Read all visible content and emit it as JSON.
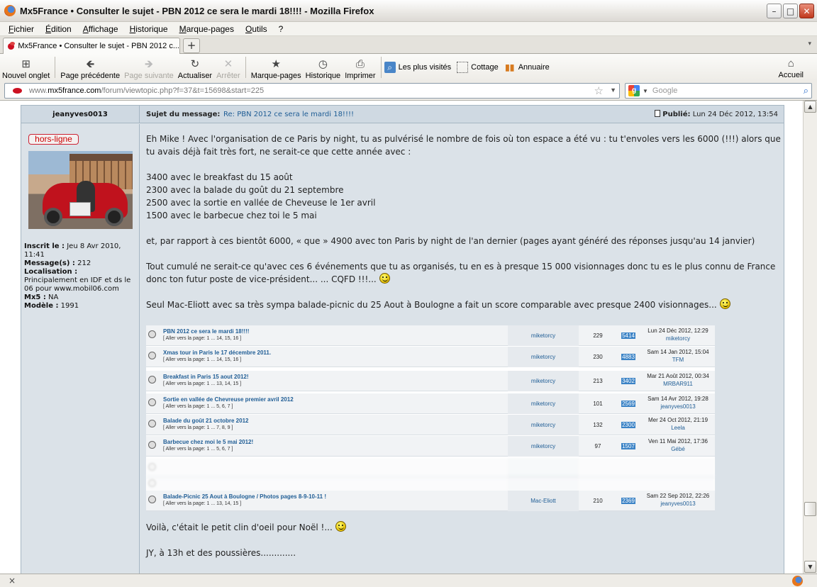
{
  "window": {
    "title": "Mx5France • Consulter le sujet - PBN 2012 ce sera le mardi 18!!!! - Mozilla Firefox",
    "minimize": "–",
    "maximize": "□",
    "close": "✕"
  },
  "menubar": {
    "items": [
      "Fichier",
      "Édition",
      "Affichage",
      "Historique",
      "Marque-pages",
      "Outils",
      "?"
    ]
  },
  "tabs": {
    "active_label": "Mx5France • Consulter le sujet - PBN 2012 c...",
    "new_tab": "+",
    "scroll": "▾"
  },
  "navbar": {
    "new_tab": "Nouvel onglet",
    "back": "Page précédente",
    "forward": "Page suivante",
    "reload": "Actualiser",
    "stop": "Arrêter",
    "bookmarks": "Marque-pages",
    "history": "Historique",
    "print": "Imprimer",
    "home": "Accueil",
    "bookmark_links": [
      "Les plus visités",
      "Cottage",
      "Annuaire"
    ]
  },
  "urlbar": {
    "prefix": "www.",
    "domain": "mx5france.com",
    "path": "/forum/viewtopic.php?f=37&t=15698&start=225",
    "search_placeholder": "Google"
  },
  "post": {
    "author": "jeanyves0013",
    "subject_label": "Sujet du message:",
    "subject": "Re: PBN 2012 ce sera le mardi 18!!!!",
    "posted_label": "Publié:",
    "posted_date": "Lun 24 Déc 2012, 13:54",
    "status_badge": "hors-ligne",
    "profile": {
      "joined_label": "Inscrit le :",
      "joined": "Jeu 8 Avr 2010, 11:41",
      "messages_label": "Message(s) :",
      "messages": "212",
      "location_label": "Localisation :",
      "location": "Principalement en IDF et ds le 06 pour www.mobil06.com",
      "mx5_label": "Mx5 :",
      "mx5": "NA",
      "model_label": "Modèle :",
      "model": "1991"
    },
    "paragraphs": {
      "p1": "Eh Mike ! Avec l'organisation de ce Paris by night, tu as pulvérisé le nombre de fois où ton espace a été vu : tu t'envoles vers les 6000 (!!!) alors que tu avais déjà fait très fort, ne serait-ce que cette année avec :",
      "l1": "3400 avec le breakfast du 15 août",
      "l2": "2300 avec la balade du goût du 21 septembre",
      "l3": "2500 avec la sortie en vallée de Cheveuse le 1er avril",
      "l4": "1500 avec le barbecue chez toi le 5 mai",
      "p2": "et, par rapport à ces bientôt 6000, « que » 4900 avec ton Paris by night de l'an dernier (pages ayant généré des réponses jusqu'au 14 janvier)",
      "p3": "Tout cumulé ne serait-ce qu'avec ces 6 événements que tu as organisés, tu en es à presque 15 000 visionnages donc tu es le plus connu de France donc ton futur poste de vice-président... ... CQFD !!!...",
      "p4": "Seul Mac-Eliott avec sa très sympa balade-picnic du 25 Aout à Boulogne a fait un score comparable avec presque 2400 visionnages...",
      "p5": "Voilà, c'était le petit clin d'oeil pour Noël !...",
      "p6": "JY, à 13h et des poussières............."
    },
    "embedded_topics": [
      {
        "title": "PBN 2012 ce sera le mardi 18!!!!",
        "pages": "[ Aller vers la page: 1 ... 14, 15, 16 ]",
        "author": "miketorcy",
        "replies": "229",
        "views": "5414",
        "last_date": "Lun 24 Déc 2012, 12:29",
        "last_user": "miketorcy"
      },
      {
        "title": "Xmas tour in Paris le 17 décembre 2011.",
        "pages": "[ Aller vers la page: 1 ... 14, 15, 16 ]",
        "author": "miketorcy",
        "replies": "230",
        "views": "4883",
        "last_date": "Sam 14 Jan 2012, 15:04",
        "last_user": "TFM"
      },
      {
        "title": "Breakfast in Paris 15 aout 2012!",
        "pages": "[ Aller vers la page: 1 ... 13, 14, 15 ]",
        "author": "miketorcy",
        "replies": "213",
        "views": "3402",
        "last_date": "Mar 21 Août 2012, 00:34",
        "last_user": "MRBAR911"
      },
      {
        "title": "Sortie en vallée de Chevreuse premier avril 2012",
        "pages": "[ Aller vers la page: 1 ... 5, 6, 7 ]",
        "author": "miketorcy",
        "replies": "101",
        "views": "2569",
        "last_date": "Sam 14 Avr 2012, 19:28",
        "last_user": "jeanyves0013"
      },
      {
        "title": "Balade du goût 21 octobre 2012",
        "pages": "[ Aller vers la page: 1 ... 7, 8, 9 ]",
        "author": "miketorcy",
        "replies": "132",
        "views": "2300",
        "last_date": "Mer 24 Oct 2012, 21:19",
        "last_user": "Leela"
      },
      {
        "title": "Barbecue chez moi le 5 mai 2012!",
        "pages": "[ Aller vers la page: 1 ... 5, 6, 7 ]",
        "author": "miketorcy",
        "replies": "97",
        "views": "1507",
        "last_date": "Ven 11 Mai 2012, 17:36",
        "last_user": "Gébé"
      },
      {
        "title": "Balade-Picnic 25 Aout à Boulogne / Photos pages 8-9-10-11 !",
        "pages": "[ Aller vers la page: 1 ... 13, 14, 15 ]",
        "author": "Mac-Eliott",
        "replies": "210",
        "views": "2369",
        "last_date": "Sam 22 Sep 2012, 22:26",
        "last_user": "jeanyves0013"
      }
    ]
  },
  "statusbar": {
    "close": "×"
  }
}
